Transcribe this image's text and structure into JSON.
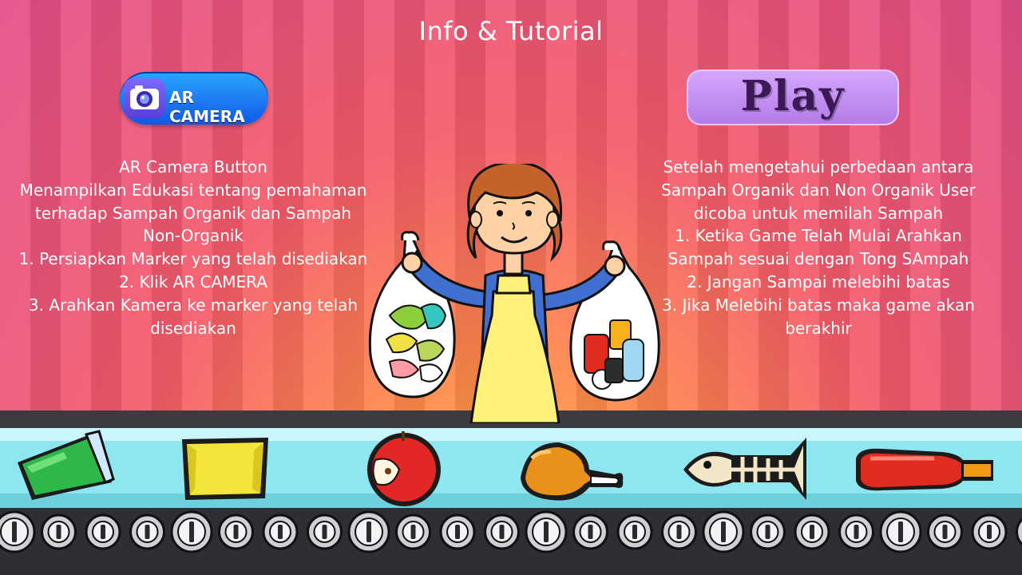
{
  "screen": {
    "title": "Info & Tutorial"
  },
  "buttons": {
    "ar_camera": {
      "label": "AR CAMERA",
      "icon": "camera-icon"
    },
    "play": {
      "label": "Play"
    }
  },
  "info_left": {
    "lines": [
      "AR Camera Button",
      "Menampilkan Edukasi tentang pemahaman",
      "terhadap Sampah Organik dan Sampah",
      "Non-Organik",
      "1. Persiapkan Marker yang telah disediakan",
      "2. Klik AR CAMERA",
      "3. Arahkan Kamera ke marker yang telah",
      "disediakan"
    ]
  },
  "info_right": {
    "lines": [
      "Setelah mengetahui perbedaan antara",
      "Sampah Organik dan Non Organik User",
      "dicoba untuk memilah Sampah",
      "1. Ketika Game Telah Mulai Arahkan",
      "Sampah sesuai dengan Tong SAmpah",
      "2. Jangan Sampai melebihi batas",
      "3. Jika Melebihi batas maka game akan",
      "berakhir"
    ]
  },
  "belt_items": [
    {
      "name": "green-cup-icon"
    },
    {
      "name": "yellow-snack-wrapper-icon"
    },
    {
      "name": "apple-core-icon"
    },
    {
      "name": "chicken-leg-icon"
    },
    {
      "name": "fish-bone-icon"
    },
    {
      "name": "red-bottle-icon"
    }
  ],
  "colors": {
    "background_top": "#e34f8a",
    "background_glow": "#ffb347",
    "belt_surface": "#8ee6f0",
    "ar_button": "#1a7cf0",
    "play_button": "#c393f0",
    "text": "#ffffff"
  }
}
